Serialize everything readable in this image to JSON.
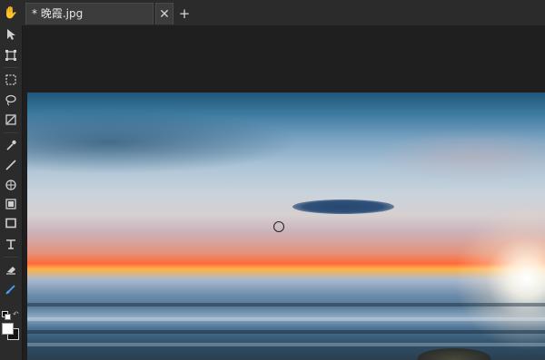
{
  "document": {
    "tab_title": "* 晚霞.jpg",
    "close_glyph": "✕",
    "add_glyph": "+"
  },
  "tools": [
    {
      "name": "hand-tool",
      "icon": "hand-icon"
    },
    {
      "name": "move-tool",
      "icon": "pointer-arrow-icon"
    },
    {
      "name": "transform-tool",
      "icon": "transform-icon"
    },
    {
      "name": "rect-select-tool",
      "icon": "marquee-icon"
    },
    {
      "name": "lasso-tool",
      "icon": "lasso-icon"
    },
    {
      "name": "crop-tool",
      "icon": "crop-icon"
    },
    {
      "name": "eyedropper-tool",
      "icon": "eyedropper-icon"
    },
    {
      "name": "brush-tool",
      "icon": "brush-icon"
    },
    {
      "name": "stamp-tool",
      "icon": "stamp-icon"
    },
    {
      "name": "layer-tool",
      "icon": "layer-icon"
    },
    {
      "name": "shape-tool",
      "icon": "rectangle-icon"
    },
    {
      "name": "text-tool",
      "icon": "text-icon"
    },
    {
      "name": "eraser-tool",
      "icon": "eraser-icon"
    },
    {
      "name": "smudge-tool",
      "icon": "smudge-icon",
      "active": true
    }
  ],
  "colors": {
    "foreground": "#ffffff",
    "background": "#111111",
    "accent": "#4aa3ff"
  }
}
